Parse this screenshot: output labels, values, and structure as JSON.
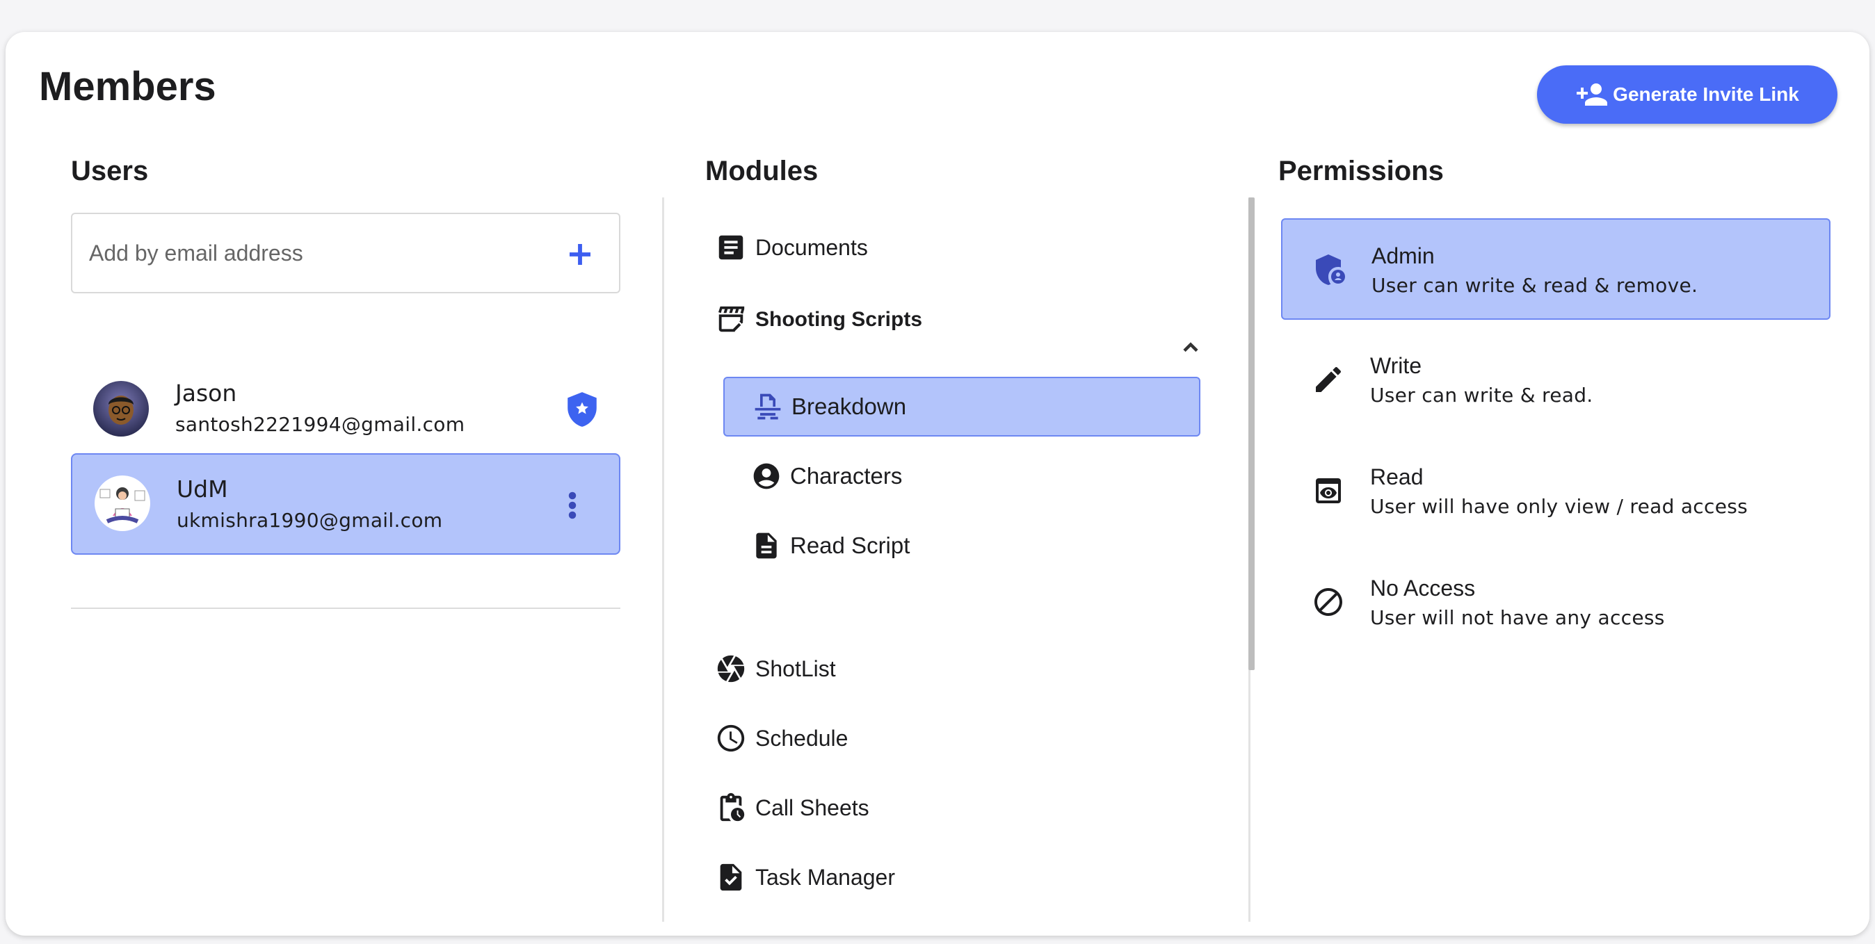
{
  "page": {
    "title": "Members"
  },
  "actions": {
    "invite_label": "Generate Invite Link",
    "invite_icon": "person-add-icon"
  },
  "users": {
    "heading": "Users",
    "email_placeholder": "Add by email address",
    "items": [
      {
        "name": "Jason",
        "email": "santosh2221994@gmail.com",
        "badge": "admin-shield-icon",
        "selected": false
      },
      {
        "name": "UdM",
        "email": "ukmishra1990@gmail.com",
        "badge": "more-vertical-icon",
        "selected": true
      }
    ]
  },
  "modules": {
    "heading": "Modules",
    "items": [
      {
        "label": "Documents",
        "icon": "document-icon"
      },
      {
        "label": "Shooting Scripts",
        "icon": "clapperboard-icon",
        "expanded": true,
        "children": [
          {
            "label": "Breakdown",
            "icon": "breakdown-icon",
            "selected": true
          },
          {
            "label": "Characters",
            "icon": "account-circle-icon"
          },
          {
            "label": "Read Script",
            "icon": "file-icon"
          }
        ]
      },
      {
        "label": "ShotList",
        "icon": "camera-shutter-icon"
      },
      {
        "label": "Schedule",
        "icon": "clock-icon"
      },
      {
        "label": "Call Sheets",
        "icon": "clipboard-clock-icon"
      },
      {
        "label": "Task Manager",
        "icon": "task-check-icon"
      }
    ]
  },
  "permissions": {
    "heading": "Permissions",
    "items": [
      {
        "title": "Admin",
        "desc": "User can write & read & remove.",
        "icon": "admin-shield-icon",
        "selected": true
      },
      {
        "title": "Write",
        "desc": "User can write & read.",
        "icon": "pencil-icon"
      },
      {
        "title": "Read",
        "desc": "User will have only view / read access",
        "icon": "eye-window-icon"
      },
      {
        "title": "No Access",
        "desc": "User will not have any access",
        "icon": "block-icon"
      }
    ]
  },
  "colors": {
    "accent": "#4a6cf7",
    "selected_bg": "#b3c4fb",
    "selected_border": "#6d87f2"
  }
}
